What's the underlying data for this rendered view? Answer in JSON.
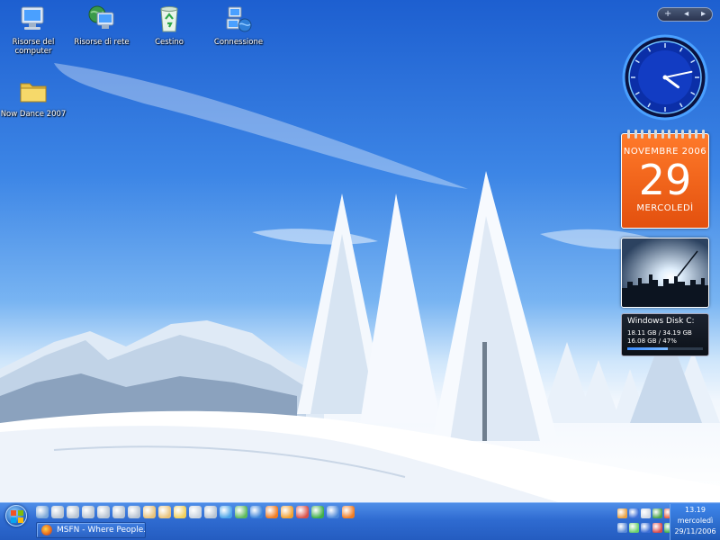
{
  "desktop": {
    "icons": [
      {
        "label": "Risorse del computer",
        "icon": "my-computer-icon"
      },
      {
        "label": "Risorse di rete",
        "icon": "network-places-icon"
      },
      {
        "label": "Cestino",
        "icon": "recycle-bin-icon"
      },
      {
        "label": "Connessione",
        "icon": "network-connection-icon"
      },
      {
        "label": "Now Dance 2007",
        "icon": "folder-icon"
      }
    ]
  },
  "sidebar": {
    "controls": {
      "add": "+",
      "prev": "◂",
      "next": "▸"
    },
    "calendar": {
      "month": "NOVEMBRE 2006",
      "day": "29",
      "weekday": "MERCOLEDÌ"
    },
    "clock": {
      "hour": 4,
      "minute": 13
    },
    "disk": {
      "title": "Windows Disk C:",
      "usage": "18.11 GB / 34.19 GB",
      "free": "16.08 GB / 47%",
      "used_fraction": 0.53
    }
  },
  "taskbar": {
    "start": {
      "icon": "windows-orb-icon"
    },
    "quick_launch": [
      "network-icon",
      "drive-icon",
      "drive-icon",
      "drive-icon",
      "drive-icon",
      "drive-icon",
      "drive-icon",
      "user-icon",
      "user-icon",
      "folder-icon",
      "printer-icon",
      "drive-icon",
      "globe-icon",
      "refresh-icon",
      "internet-explorer-icon",
      "firefox-icon",
      "media-icon",
      "paint-icon",
      "messenger-icon",
      "play-icon",
      "firefox-icon"
    ],
    "tasks": [
      {
        "label": "MSFN - Where People...",
        "icon": "firefox-icon"
      }
    ],
    "tray": [
      "gear-icon",
      "monitor-icon",
      "mail-icon",
      "user-icon",
      "shield-icon",
      "network-icon",
      "volume-icon",
      "monitor-icon",
      "update-icon",
      "security-icon"
    ],
    "clock": {
      "time": "13.19",
      "weekday": "mercoledì",
      "date": "29/11/2006"
    }
  },
  "colors": {
    "taskbar": "#2f6bd1",
    "calendar": "#f06a1e",
    "accent": "#1e5fd2"
  }
}
